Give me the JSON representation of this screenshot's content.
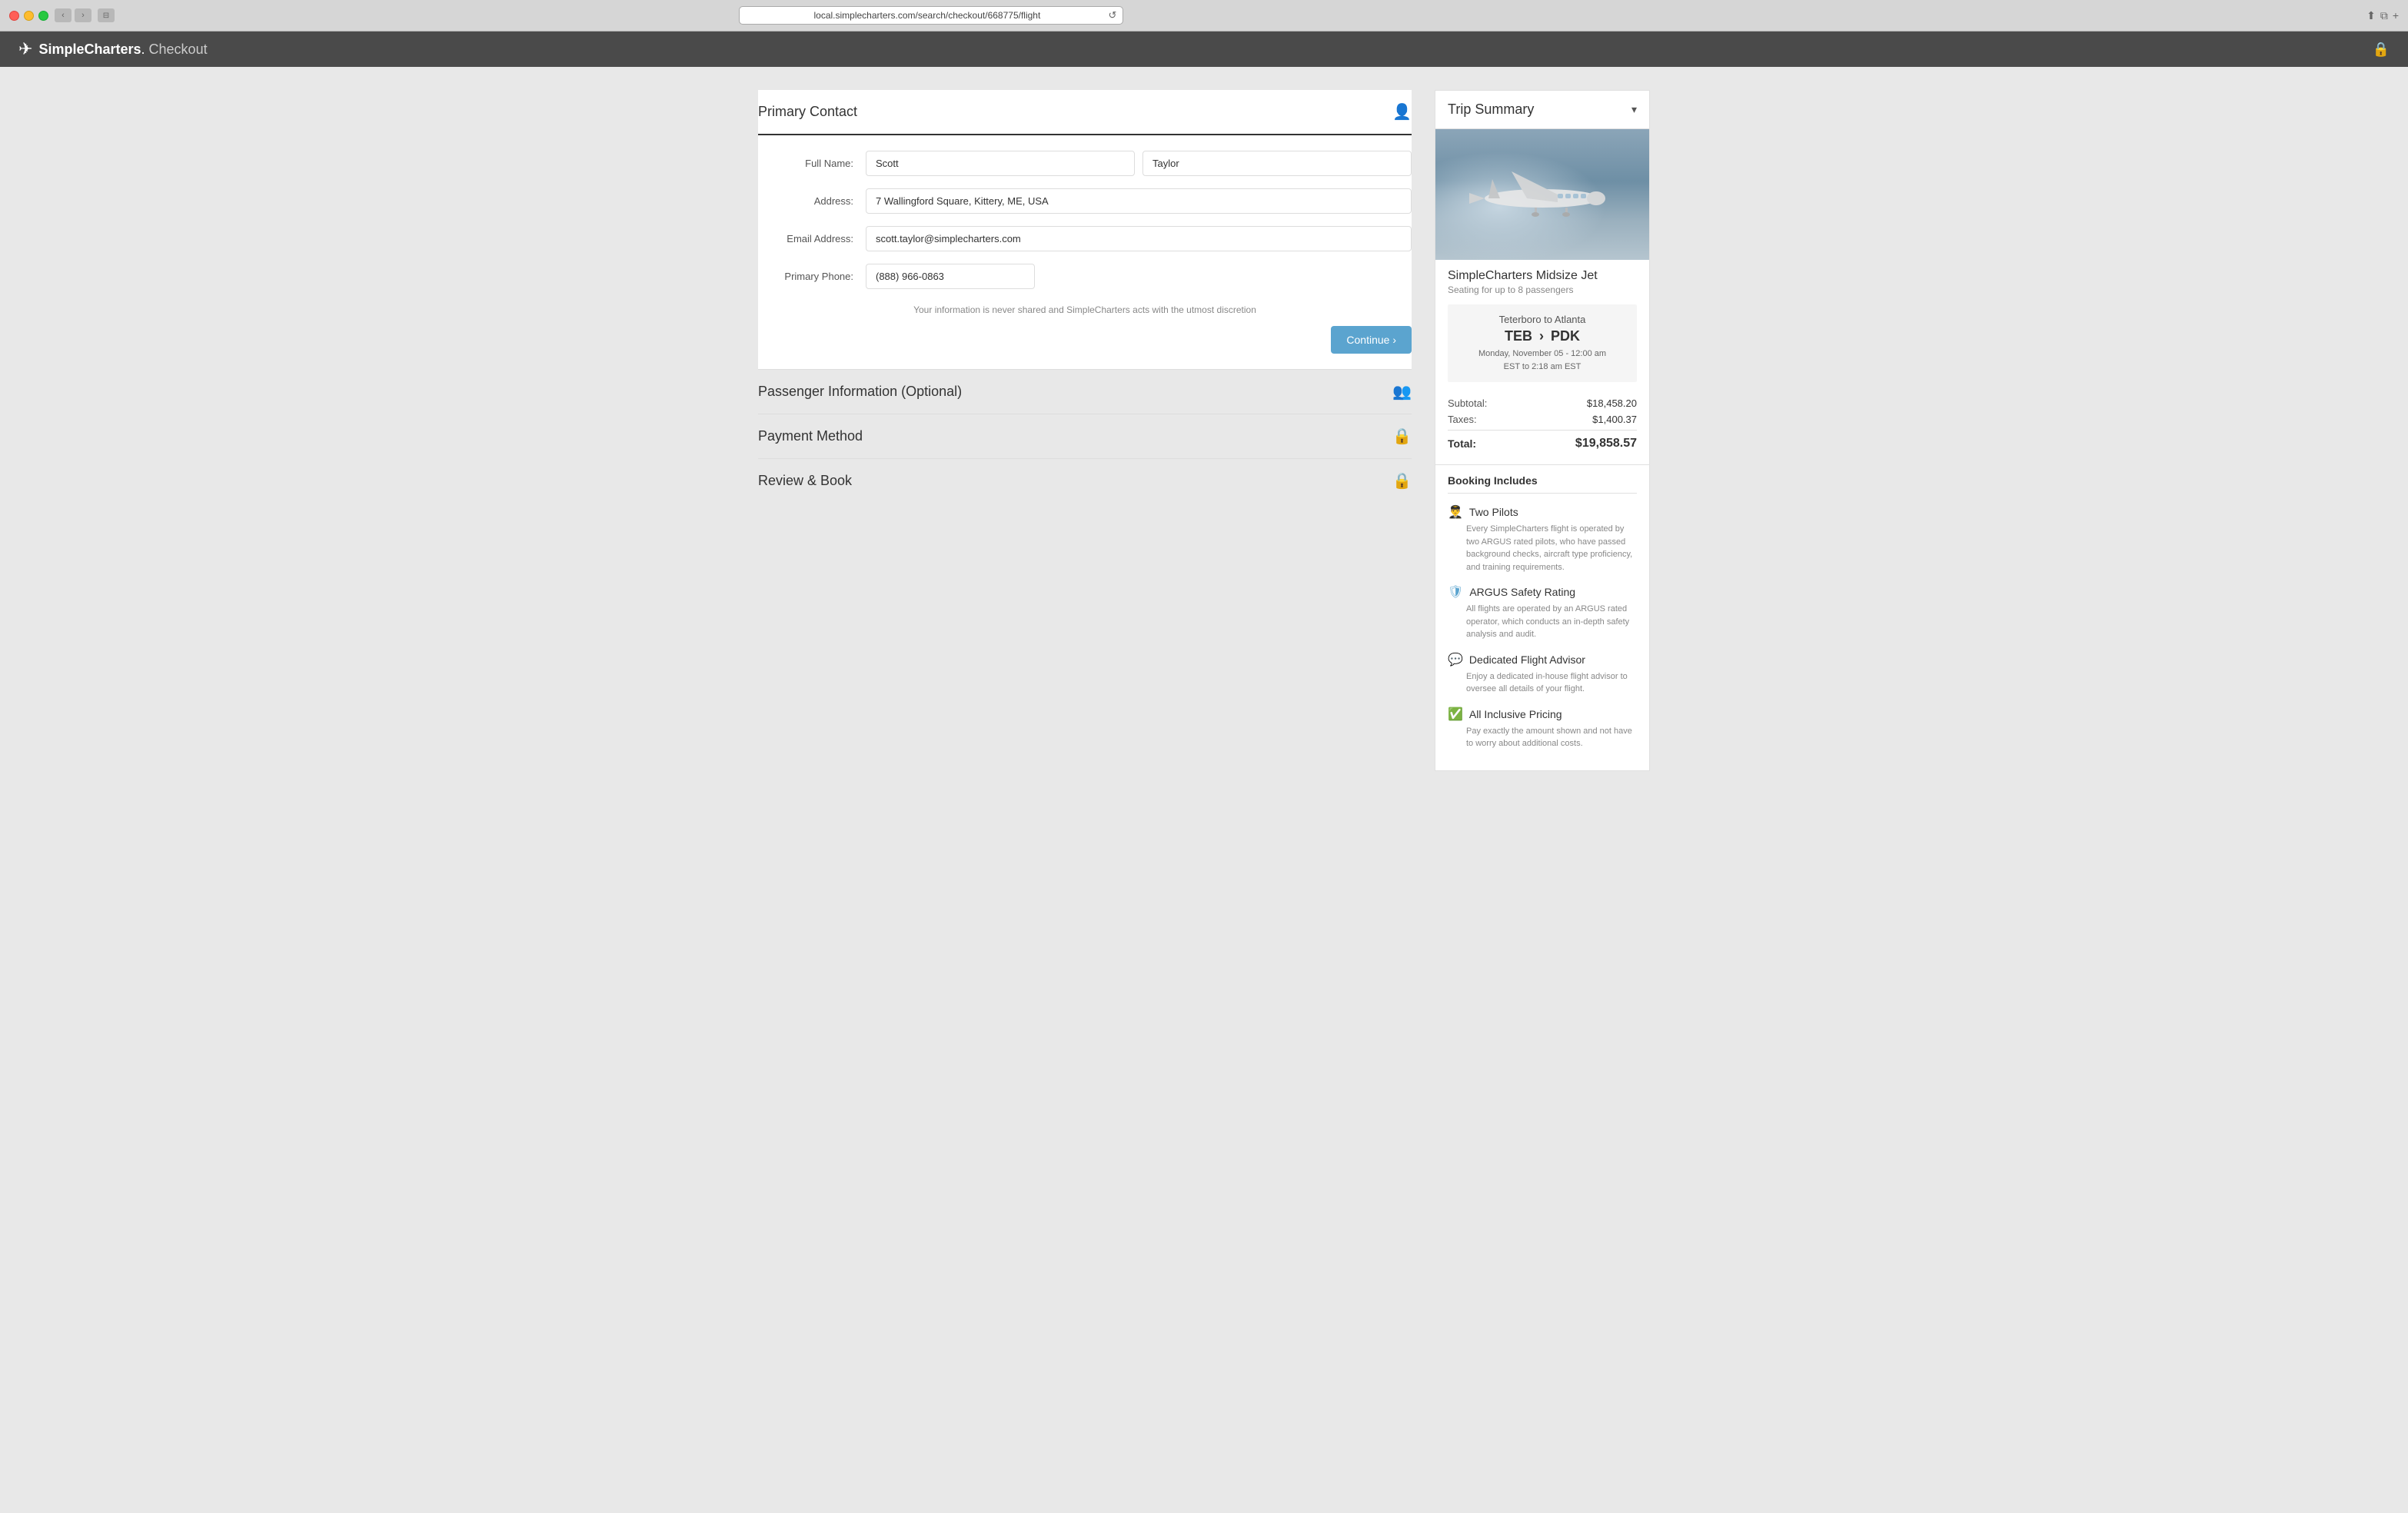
{
  "browser": {
    "url": "local.simplecharters.com/search/checkout/668775/flight",
    "refresh_icon": "↺"
  },
  "header": {
    "logo_name": "SimpleCharters",
    "dot": ".",
    "checkout_label": "Checkout",
    "lock_icon": "🔒"
  },
  "primary_contact": {
    "title": "Primary Contact",
    "icon": "👤",
    "fields": {
      "full_name_label": "Full Name:",
      "first_name_value": "Scott",
      "last_name_value": "Taylor",
      "address_label": "Address:",
      "address_value": "7 Wallingford Square, Kittery, ME, USA",
      "email_label": "Email Address:",
      "email_value": "scott.taylor@simplecharters.com",
      "phone_label": "Primary Phone:",
      "phone_value": "(888) 966-0863"
    },
    "privacy_note": "Your information is never shared and SimpleCharters acts with the utmost discretion",
    "continue_btn": "Continue ›"
  },
  "passenger_info": {
    "title": "Passenger Information (Optional)",
    "icon": "👥"
  },
  "payment_method": {
    "title": "Payment Method",
    "icon": "🔒"
  },
  "review_book": {
    "title": "Review & Book",
    "icon": "🔒"
  },
  "trip_summary": {
    "title": "Trip Summary",
    "chevron": "▾",
    "jet_name": "SimpleCharters Midsize Jet",
    "jet_seating": "Seating for up to 8 passengers",
    "route_label": "Teterboro to Atlanta",
    "route_from": "TEB",
    "route_arrow": "›",
    "route_to": "PDK",
    "flight_time_line1": "Monday, November 05 - 12:00 am",
    "flight_time_line2": "EST to 2:18 am EST",
    "subtotal_label": "Subtotal:",
    "subtotal_value": "$18,458.20",
    "taxes_label": "Taxes:",
    "taxes_value": "$1,400.37",
    "total_label": "Total:",
    "total_value": "$19,858.57",
    "booking_includes_title": "Booking Includes",
    "includes": [
      {
        "icon": "👫",
        "title": "Two Pilots",
        "desc": "Every SimpleCharters flight is operated by two ARGUS rated pilots, who have passed background checks, aircraft type proficiency, and training requirements."
      },
      {
        "icon": "🛡",
        "title": "ARGUS Safety Rating",
        "desc": "All flights are operated by an ARGUS rated operator, which conducts an in-depth safety analysis and audit."
      },
      {
        "icon": "💬",
        "title": "Dedicated Flight Advisor",
        "desc": "Enjoy a dedicated in-house flight advisor to oversee all details of your flight."
      },
      {
        "icon": "✓",
        "title": "All Inclusive Pricing",
        "desc": "Pay exactly the amount shown and not have to worry about additional costs."
      }
    ]
  }
}
